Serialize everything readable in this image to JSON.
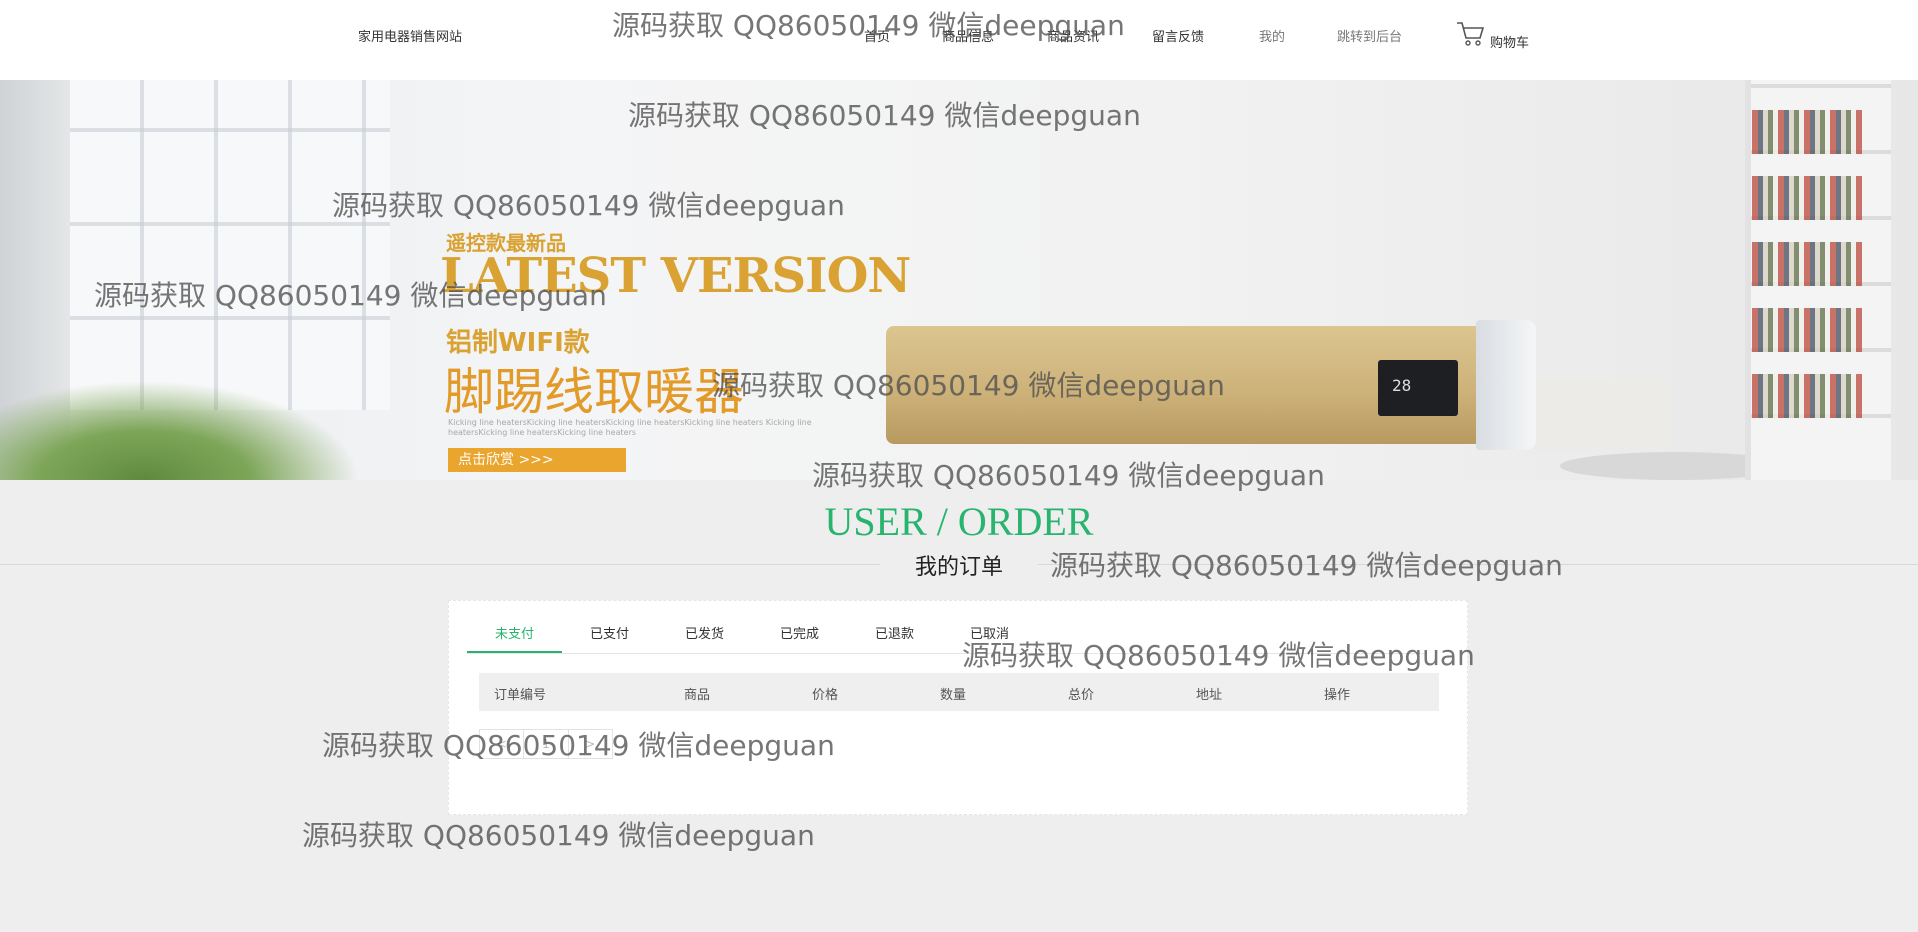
{
  "header": {
    "site_title": "家用电器销售网站",
    "nav": [
      "首页",
      "商品信息",
      "商品资讯",
      "留言反馈",
      "我的",
      "跳转到后台"
    ],
    "cart_label": "购物车"
  },
  "banner": {
    "tagline": "遥控款最新品",
    "headline": "LATEST VERSION",
    "model": "铝制WIFI款",
    "product_name": "脚踢线取暖器",
    "fine_print": "Kicking line heatersKicking line heatersKicking line heatersKicking line heaters Kicking line heatersKicking line heatersKicking line heaters",
    "cta": "点击欣赏 >>>",
    "display_reading": "28"
  },
  "section": {
    "title": "USER / ORDER",
    "subtitle": "我的订单"
  },
  "orders": {
    "tabs": [
      "未支付",
      "已支付",
      "已发货",
      "已完成",
      "已退款",
      "已取消"
    ],
    "active_tab": "未支付",
    "columns": [
      "订单编号",
      "商品",
      "价格",
      "数量",
      "总价",
      "地址",
      "操作"
    ],
    "pager": [
      "<",
      "1",
      ">"
    ]
  },
  "watermark": "源码获取 QQ86050149 微信deepguan",
  "colors": {
    "accent": "#28b46e",
    "banner_gold": "#d9a232",
    "background": "#eeeeee"
  }
}
